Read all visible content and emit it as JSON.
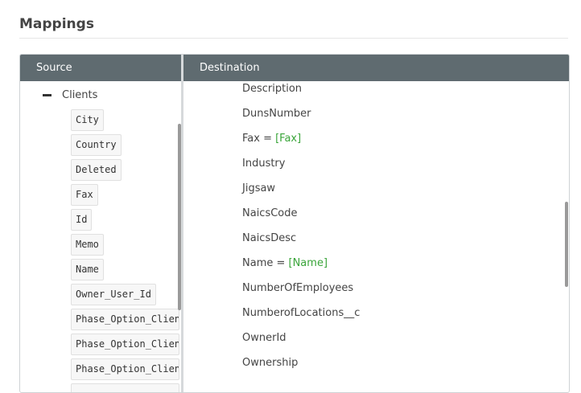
{
  "page": {
    "title": "Mappings"
  },
  "panel": {
    "source_header": "Source",
    "destination_header": "Destination"
  },
  "source": {
    "root_label": "Clients",
    "root_icon": "collapse-icon",
    "fields": [
      "City",
      "Country",
      "Deleted",
      "Fax",
      "Id",
      "Memo",
      "Name",
      "Owner_User_Id",
      "Phase_Option_Client",
      "Phase_Option_Client",
      "Phase_Option_Client"
    ]
  },
  "destination": {
    "fields": [
      {
        "name": "Description",
        "mapping": ""
      },
      {
        "name": "DunsNumber",
        "mapping": ""
      },
      {
        "name": "Fax = ",
        "mapping": "[Fax]"
      },
      {
        "name": "Industry",
        "mapping": ""
      },
      {
        "name": "Jigsaw",
        "mapping": ""
      },
      {
        "name": "NaicsCode",
        "mapping": ""
      },
      {
        "name": "NaicsDesc",
        "mapping": ""
      },
      {
        "name": "Name = ",
        "mapping": "[Name]"
      },
      {
        "name": "NumberOfEmployees",
        "mapping": ""
      },
      {
        "name": "NumberofLocations__c",
        "mapping": ""
      },
      {
        "name": "OwnerId",
        "mapping": ""
      },
      {
        "name": "Ownership",
        "mapping": ""
      }
    ]
  },
  "colors": {
    "header_bg": "#5f6b70",
    "mapping_value": "#3aa53a"
  }
}
